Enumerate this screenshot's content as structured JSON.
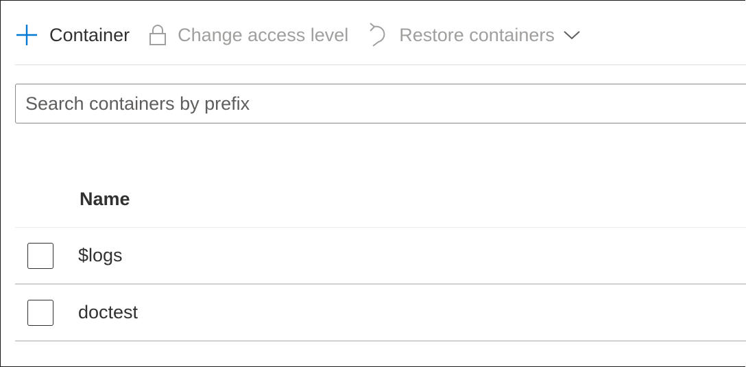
{
  "toolbar": {
    "add_container_label": "Container",
    "change_access_label": "Change access level",
    "restore_label": "Restore containers"
  },
  "search": {
    "placeholder": "Search containers by prefix",
    "value": ""
  },
  "table": {
    "columns": [
      "Name"
    ],
    "rows": [
      {
        "name": "$logs"
      },
      {
        "name": "doctest"
      }
    ]
  },
  "colors": {
    "accent": "#0078d4",
    "disabled_text": "#a19f9d",
    "text": "#323130"
  },
  "icons": {
    "add": "plus-icon",
    "access": "lock-icon",
    "restore": "undo-icon",
    "dropdown": "chevron-down-icon"
  }
}
